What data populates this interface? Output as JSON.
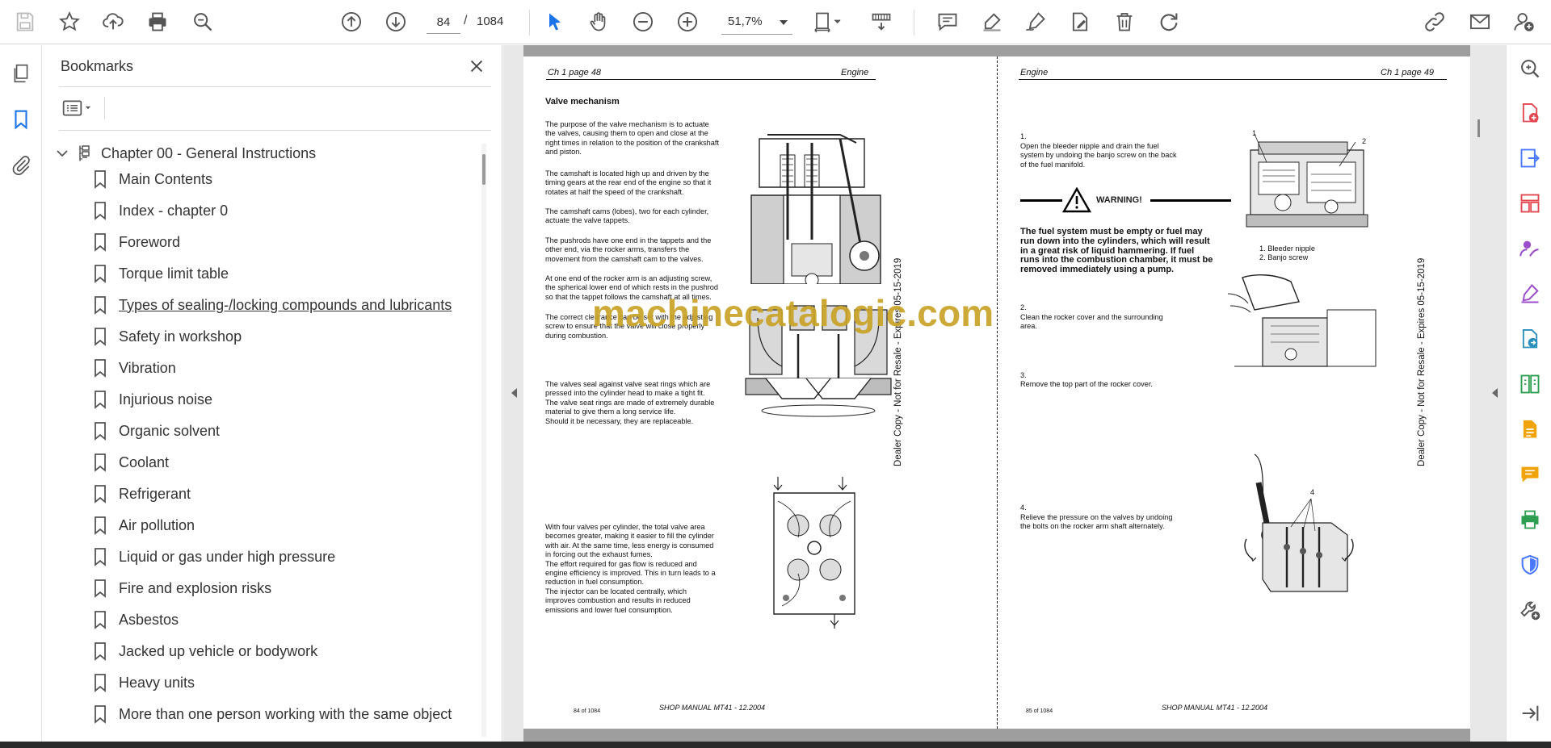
{
  "toolbar": {
    "current_page": "84",
    "page_separator": "/",
    "total_pages": "1084",
    "zoom": "51,7%"
  },
  "bookmarks": {
    "title": "Bookmarks",
    "chapter": "Chapter 00 - General Instructions",
    "items": [
      "Main Contents",
      "Index - chapter 0",
      "Foreword",
      "Torque limit table",
      "Types of sealing-/locking compounds and lubricants",
      "Safety in workshop",
      "Vibration",
      "Injurious noise",
      "Organic solvent",
      "Coolant",
      "Refrigerant",
      "Air pollution",
      "Liquid or gas under high pressure",
      "Fire and explosion risks",
      "Asbestos",
      "Jacked up vehicle or bodywork",
      "Heavy units",
      "More than one person working with the same object"
    ]
  },
  "document": {
    "left_page": {
      "header_left": "Ch 1 page 48",
      "header_right": "Engine",
      "section_title": "Valve mechanism",
      "paragraphs": [
        "The purpose of the valve mechanism is to actuate the valves, causing them to open and close at the right times in relation to the position of the crankshaft and piston.",
        "The camshaft is located high up and driven by the timing gears at the rear end of the engine so that it rotates at half the speed of the crankshaft.",
        "The camshaft cams (lobes), two for each cylinder, actuate the valve tappets.",
        "The pushrods have one end in the tappets and the other end, via the rocker arms, transfers the movement from the camshaft cam to the valves.",
        "At one end of the rocker arm is an adjusting screw, the spherical lower end of which rests in the pushrod so that the tappet follows the camshaft at all times.",
        "The correct clearance can be set with the adjusting screw to ensure that the valve will close properly during combustion.",
        "The valves seal against valve seat rings which are pressed into the cylinder head to make a tight fit.\nThe valve seat rings are made of extremely durable material to give them a long service life.\nShould it be necessary, they are replaceable.",
        "With four valves per cylinder, the total valve area becomes greater, making it easier to fill the cylinder with air. At the same time, less energy is consumed in forcing out the exhaust fumes.\nThe effort required for gas flow is reduced and engine efficiency is improved. This in turn leads to a reduction in fuel consumption.\nThe injector can be located centrally, which improves combustion and results in reduced emissions and lower fuel consumption."
      ],
      "footer_page": "84 of 1084",
      "footer_title": "SHOP MANUAL MT41 - 12.2004",
      "dealer_stamp": "Dealer Copy - Not for Resale - Expires 05-15-2019"
    },
    "right_page": {
      "header_left": "Engine",
      "header_right": "Ch 1 page 49",
      "step1_num": "1.",
      "step1": "Open the bleeder nipple and drain the fuel system by undoing the banjo screw on the back of the fuel manifold.",
      "warning_label": "WARNING!",
      "warning_text": "The fuel system must be empty or fuel may run down into the cylinders, which will result in a great risk of liquid hammering. If fuel runs into the combustion chamber, it must be removed immediately using a pump.",
      "legend1": "1. Bleeder nipple",
      "legend2": "2. Banjo screw",
      "callout1": "1",
      "callout2": "2",
      "callout4": "4",
      "step2_num": "2.",
      "step2": "Clean the rocker cover and the surrounding area.",
      "step3_num": "3.",
      "step3": "Remove the top part of the rocker cover.",
      "step4_num": "4.",
      "step4": "Relieve the pressure on the valves by undoing the bolts on the rocker arm shaft alternately.",
      "footer_page": "85 of 1084",
      "footer_title": "SHOP MANUAL MT41 - 12.2004",
      "dealer_stamp": "Dealer Copy - Not for Resale - Expires 05-15-2019"
    },
    "watermark": "machinecatalogic.com"
  },
  "colors": {
    "accent_blue": "#1a73e8",
    "watermark_gold": "#c9a227",
    "tool_red": "#e34850",
    "tool_purple": "#9b4dca",
    "tool_green": "#2d9d4f",
    "tool_orange": "#f0a30a"
  }
}
